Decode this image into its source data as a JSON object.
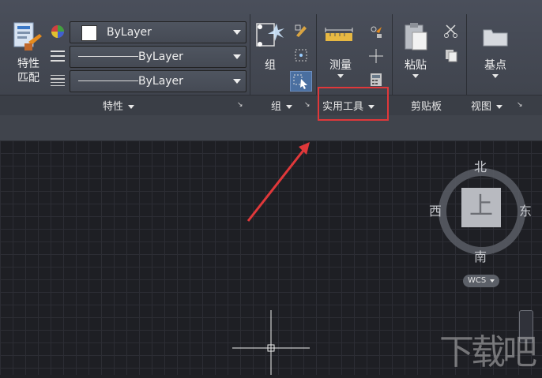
{
  "properties": {
    "match_label_line1": "特性",
    "match_label_line2": "匹配",
    "color_dropdown": "ByLayer",
    "linetype_dropdown": "ByLayer",
    "lineweight_dropdown": "ByLayer",
    "panel_label": "特性"
  },
  "group": {
    "button_label": "组",
    "panel_label": "组"
  },
  "utilities": {
    "measure_label": "测量",
    "panel_label": "实用工具"
  },
  "clipboard": {
    "paste_label": "粘贴",
    "panel_label": "剪贴板"
  },
  "view": {
    "basepoint_label": "基点",
    "panel_label": "视图"
  },
  "viewcube": {
    "north": "北",
    "south": "南",
    "west": "西",
    "east": "东",
    "face": "上",
    "wcs": "WCS"
  },
  "watermark": "下载吧",
  "colors": {
    "highlight_box": "#e0383a",
    "arrow": "#e0383a"
  }
}
